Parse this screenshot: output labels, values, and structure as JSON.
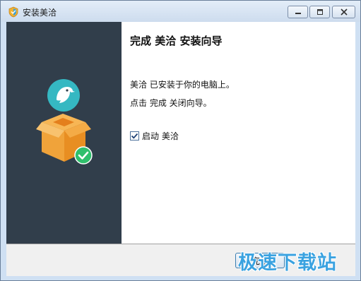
{
  "window": {
    "title": "安装美洽",
    "icons": {
      "app": "app-shield-icon",
      "minimize": "minimize-icon",
      "maximize": "maximize-icon",
      "close": "close-icon"
    }
  },
  "sidebar": {
    "icons": [
      "bird-logo-icon",
      "package-box-icon",
      "success-check-icon"
    ]
  },
  "content": {
    "heading": "完成 美洽 安装向导",
    "line1": "美洽 已安装于你的电脑上。",
    "line2": "点击 完成 关闭向导。",
    "launch_checkbox": {
      "label": "启动 美洽",
      "checked": true
    }
  },
  "footer": {
    "finish_label": "完成",
    "watermark": "极速下载站"
  },
  "colors": {
    "sidebar_bg": "#313e4b",
    "logo_teal": "#35b8c2",
    "box_orange": "#f0a33a",
    "check_green": "#2fbf6c",
    "watermark_blue": "#3aa2e0"
  }
}
